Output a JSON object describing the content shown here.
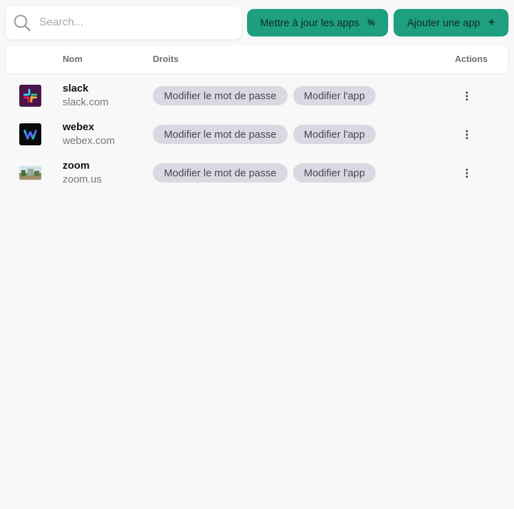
{
  "search": {
    "placeholder": "Search..."
  },
  "toolbar": {
    "update_label": "Mettre à jour les apps",
    "update_icon": "percent-icon",
    "add_label": "Ajouter une app",
    "add_icon": "plus-icon"
  },
  "table": {
    "headers": {
      "name": "Nom",
      "rights": "Droits",
      "actions": "Actions"
    },
    "rows": [
      {
        "name": "slack",
        "domain": "slack.com",
        "rights": [
          "Modifier le mot de passe",
          "Modifier l'app"
        ],
        "logo": "slack-logo"
      },
      {
        "name": "webex",
        "domain": "webex.com",
        "rights": [
          "Modifier le mot de passe",
          "Modifier l'app"
        ],
        "logo": "webex-logo"
      },
      {
        "name": "zoom",
        "domain": "zoom.us",
        "rights": [
          "Modifier le mot de passe",
          "Modifier l'app"
        ],
        "logo": "zoom-logo"
      }
    ]
  },
  "colors": {
    "accent": "#1d9f80",
    "chip": "#dcd8e1",
    "background": "#f8f8f8"
  }
}
